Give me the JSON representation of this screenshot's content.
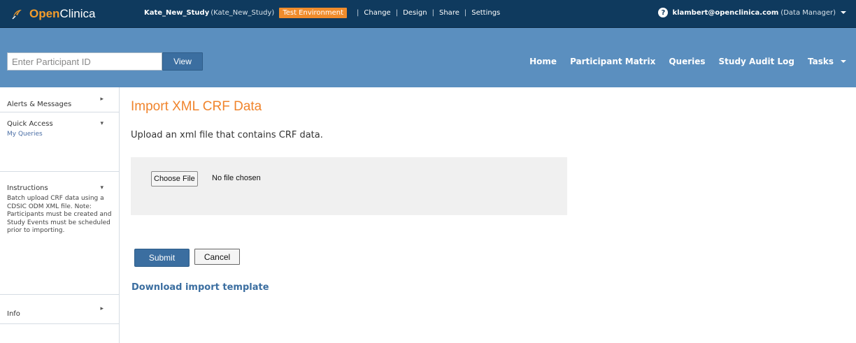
{
  "app": {
    "logo_open": "Open",
    "logo_clinica": "Clinica"
  },
  "topbar": {
    "study_name": "Kate_New_Study",
    "study_id": "(Kate_New_Study)",
    "environment": "Test Environment",
    "links": [
      "Change",
      "Design",
      "Share",
      "Settings"
    ],
    "user_email": "klambert@openclinica.com",
    "user_role": "(Data Manager)"
  },
  "navbar": {
    "participant_placeholder": "Enter Participant ID",
    "view_label": "View",
    "links": [
      "Home",
      "Participant Matrix",
      "Queries",
      "Study Audit Log",
      "Tasks"
    ]
  },
  "sidebar": {
    "alerts": "Alerts & Messages",
    "quick_access": "Quick Access",
    "my_queries": "My Queries",
    "instructions": "Instructions",
    "instructions_text": "Batch upload CRF data using a CDSIC ODM XML file. Note: Participants must be created and Study Events must be scheduled prior to importing.",
    "info": "Info"
  },
  "main": {
    "title": "Import XML CRF Data",
    "description": "Upload an xml file that contains CRF data.",
    "choose_file": "Choose File",
    "no_file": "No file chosen",
    "submit": "Submit",
    "cancel": "Cancel",
    "download": "Download import template"
  },
  "colors": {
    "topbar_bg": "#0f3a5e",
    "navbar_bg": "#5b8fbf",
    "accent_orange": "#f0842c",
    "button_blue": "#3b6ea0"
  },
  "icons": [
    "openclinica-logo-icon",
    "help-icon",
    "chevron-down-icon",
    "chevron-right-icon"
  ]
}
